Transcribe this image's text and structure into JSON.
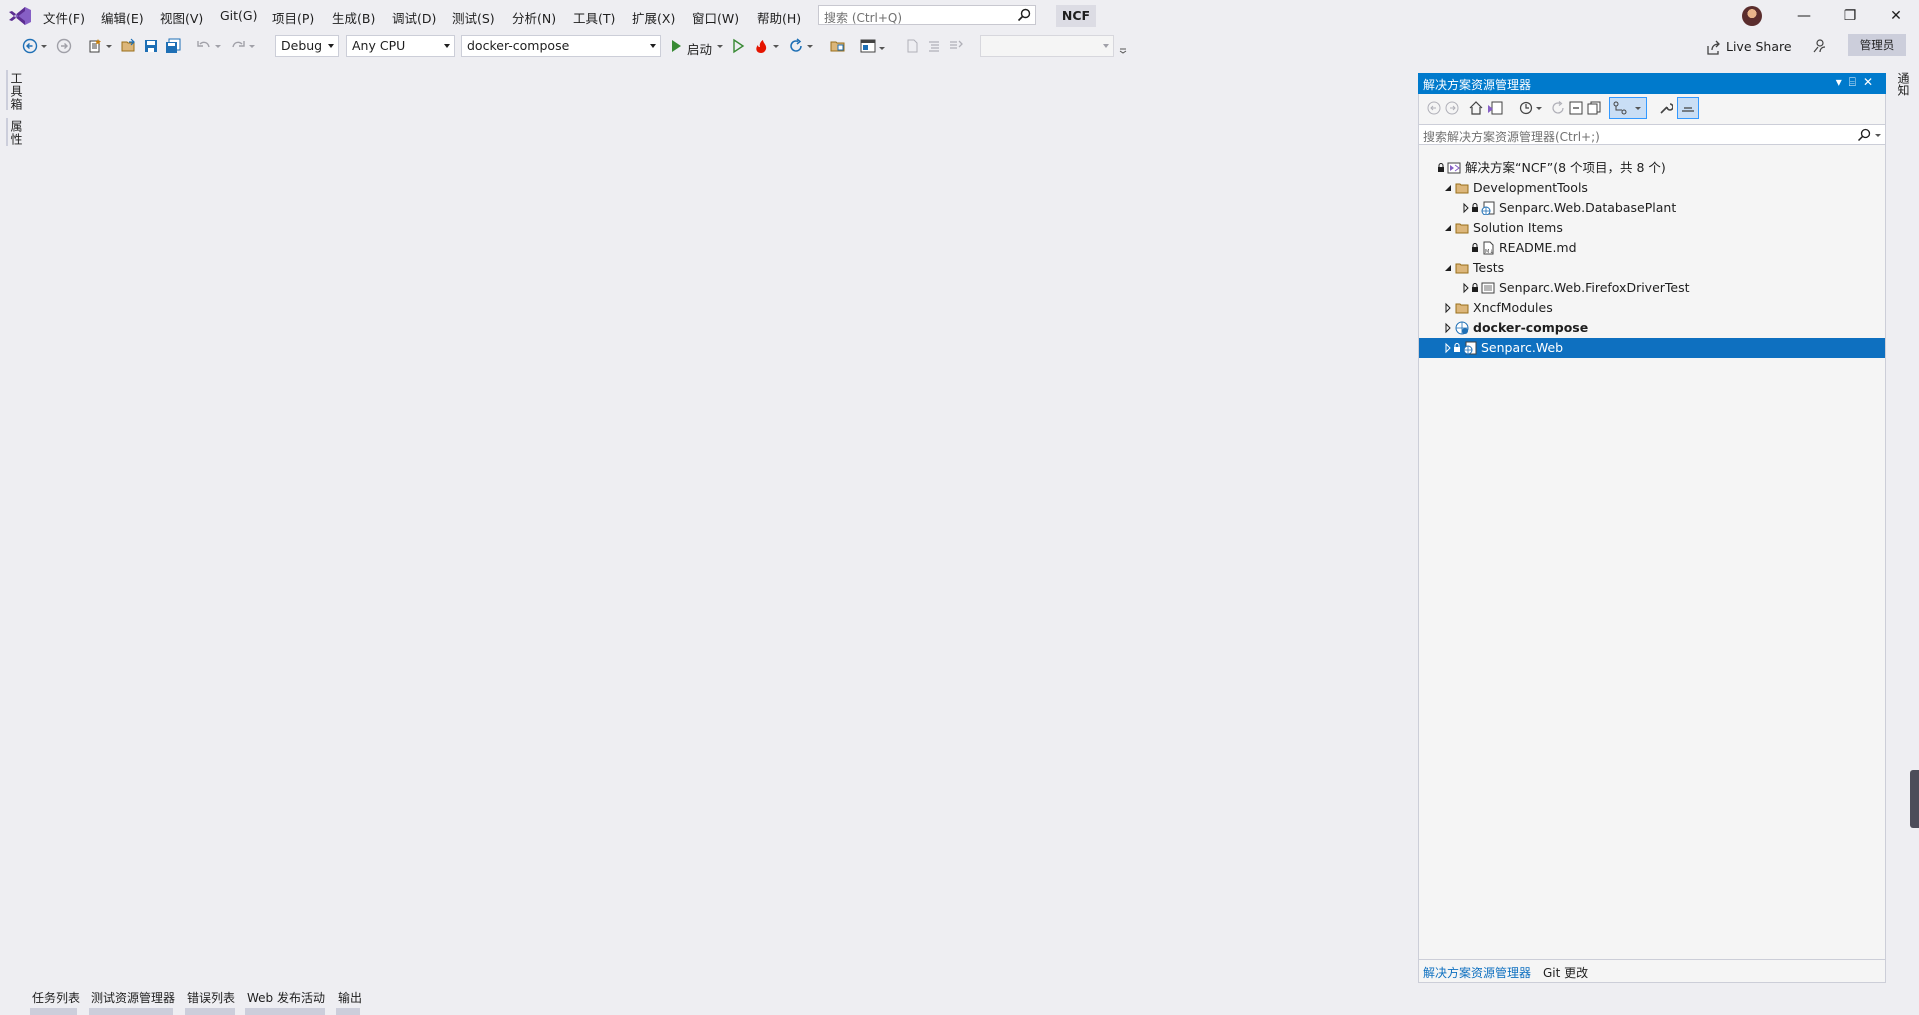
{
  "menu": {
    "items": [
      "文件(F)",
      "编辑(E)",
      "视图(V)",
      "Git(G)",
      "项目(P)",
      "生成(B)",
      "调试(D)",
      "测试(S)",
      "分析(N)",
      "工具(T)",
      "扩展(X)",
      "窗口(W)",
      "帮助(H)"
    ],
    "search_placeholder": "搜索 (Ctrl+Q)",
    "solution_name": "NCF"
  },
  "toolbar": {
    "config": "Debug",
    "platform": "Any CPU",
    "startup_project": "docker-compose",
    "start_label": "启动"
  },
  "header_right": {
    "live_share": "Live Share",
    "admin": "管理员"
  },
  "left_tabs": [
    "工具箱",
    "属性"
  ],
  "right_tabs": [
    "通知"
  ],
  "solution_explorer": {
    "title": "解决方案资源管理器",
    "search_placeholder": "搜索解决方案资源管理器(Ctrl+;)",
    "tree": [
      {
        "label": "解决方案“NCF”(8 个项目，共 8 个)",
        "icon": "solution-icon",
        "level": 0,
        "expander": "none",
        "locked": true,
        "bold": false,
        "selected": false
      },
      {
        "label": "DevelopmentTools",
        "icon": "folder-icon",
        "level": 1,
        "expander": "expanded",
        "locked": false,
        "bold": false,
        "selected": false
      },
      {
        "label": "Senparc.Web.DatabasePlant",
        "icon": "csproj-icon",
        "level": 2,
        "expander": "collapsed",
        "locked": true,
        "bold": false,
        "selected": false
      },
      {
        "label": "Solution Items",
        "icon": "folder-icon",
        "level": 1,
        "expander": "expanded",
        "locked": false,
        "bold": false,
        "selected": false
      },
      {
        "label": "README.md",
        "icon": "markdown-file-icon",
        "level": 2,
        "expander": "none",
        "locked": true,
        "bold": false,
        "selected": false
      },
      {
        "label": "Tests",
        "icon": "folder-icon",
        "level": 1,
        "expander": "expanded",
        "locked": false,
        "bold": false,
        "selected": false
      },
      {
        "label": "Senparc.Web.FirefoxDriverTest",
        "icon": "test-project-icon",
        "level": 2,
        "expander": "collapsed",
        "locked": true,
        "bold": false,
        "selected": false
      },
      {
        "label": "XncfModules",
        "icon": "folder-icon",
        "level": 1,
        "expander": "collapsed",
        "locked": false,
        "bold": false,
        "selected": false
      },
      {
        "label": "docker-compose",
        "icon": "docker-compose-icon",
        "level": 1,
        "expander": "collapsed",
        "locked": false,
        "bold": true,
        "selected": false
      },
      {
        "label": "Senparc.Web",
        "icon": "web-project-icon",
        "level": 1,
        "expander": "collapsed",
        "locked": true,
        "bold": false,
        "selected": true
      }
    ],
    "tabs": [
      "解决方案资源管理器",
      "Git 更改"
    ]
  },
  "bottom_tabs": [
    "任务列表",
    "测试资源管理器",
    "错误列表",
    "Web 发布活动",
    "输出"
  ],
  "colors": {
    "accent": "#007acc",
    "selection": "#0e70c0",
    "background": "#eeeef2",
    "vs_purple": "#865fc5"
  }
}
